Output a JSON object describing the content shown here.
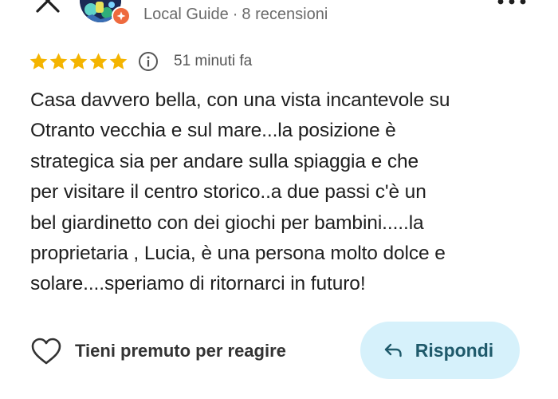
{
  "header": {
    "reviewer_tag": "Local Guide",
    "separator": "·",
    "review_count": "8 recensioni"
  },
  "rating": {
    "stars": 5,
    "max_stars": 5,
    "time_ago": "51 minuti fa"
  },
  "review": {
    "lines": [
      "Casa davvero bella, con una vista incantevole su",
      "Otranto vecchia e sul mare...la posizione è",
      "strategica sia per andare sulla spiaggia e che",
      "per visitare il centro storico..a due passi c'è un",
      "bel giardinetto con dei giochi per bambini.....la",
      "proprietaria , Lucia, è una persona molto dolce e",
      "solare....speriamo di ritornarci in futuro!"
    ]
  },
  "actions": {
    "react_label": "Tieni premuto per reagire",
    "reply_label": "Rispondi"
  },
  "colors": {
    "star": "#f4b400",
    "badge": "#ee6a3e",
    "reply_bg": "#d6f1fb",
    "reply_text": "#1f5a6b",
    "muted_text": "#6a6a6a"
  },
  "icons": {
    "close": "close-icon",
    "badge": "local-guide-badge-icon",
    "more": "more-options-icon",
    "star": "star-icon",
    "info": "info-icon",
    "heart": "heart-icon",
    "reply": "reply-arrow-icon"
  }
}
